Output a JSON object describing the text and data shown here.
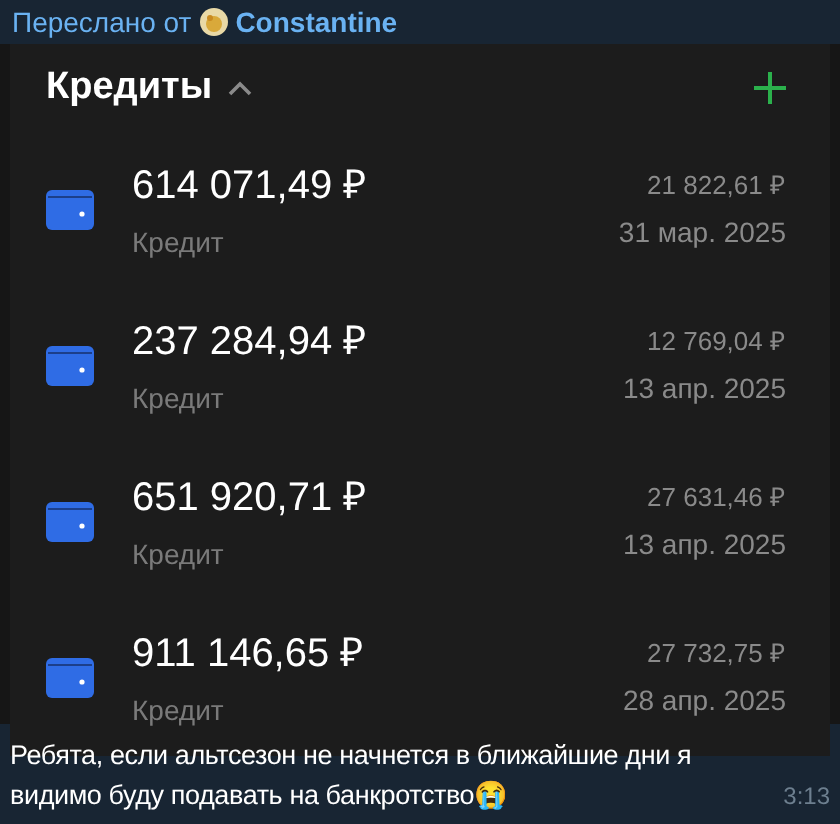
{
  "forward": {
    "prefix": "Переслано от",
    "sender": "Constantine"
  },
  "screenshot": {
    "title": "Кредиты",
    "expanded": true,
    "loans": [
      {
        "amount": "614 071,49 ₽",
        "type": "Кредит",
        "payment": "21 822,61 ₽",
        "date": "31 мар. 2025"
      },
      {
        "amount": "237 284,94 ₽",
        "type": "Кредит",
        "payment": "12 769,04 ₽",
        "date": "13 апр. 2025"
      },
      {
        "amount": "651 920,71 ₽",
        "type": "Кредит",
        "payment": "27 631,46 ₽",
        "date": "13 апр. 2025"
      },
      {
        "amount": "911 146,65 ₽",
        "type": "Кредит",
        "payment": "27 732,75 ₽",
        "date": "28 апр. 2025"
      }
    ]
  },
  "message": {
    "text": "Ребята, если альтсезон не начнется в ближайшие дни я видимо буду подавать на банкротство😭",
    "time": "3:13"
  }
}
